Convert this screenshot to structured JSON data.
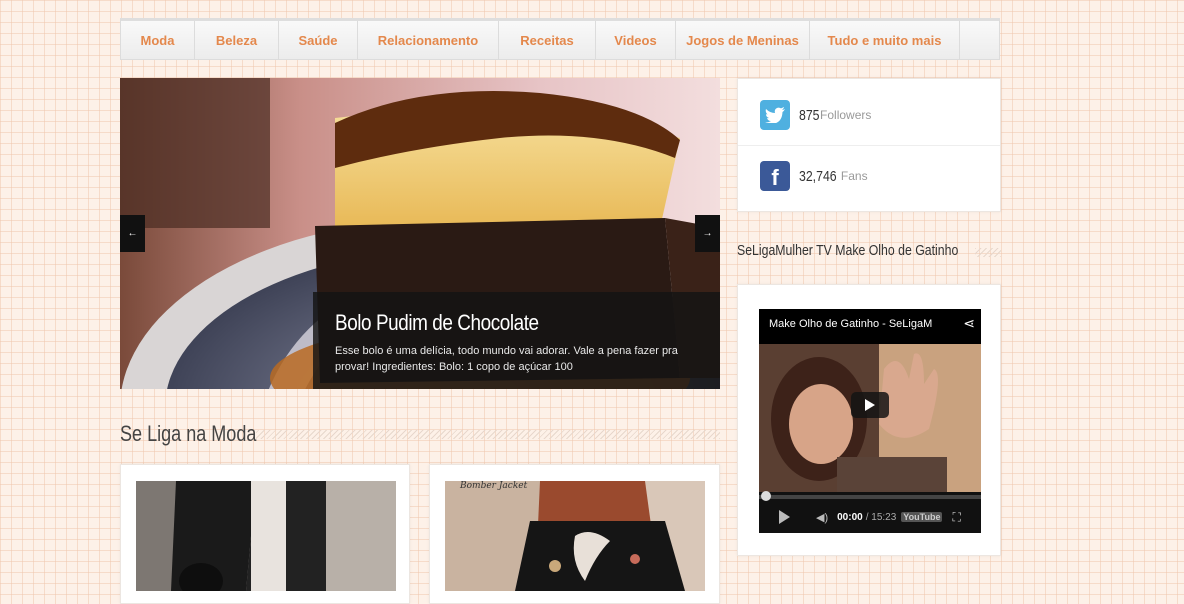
{
  "nav": {
    "items": [
      "Moda",
      "Beleza",
      "Saúde",
      "Relacionamento",
      "Receitas",
      "Videos",
      "Jogos de Meninas",
      "Tudo e muito mais"
    ]
  },
  "slider": {
    "prev_label": "←",
    "next_label": "→",
    "title": "Bolo Pudim de Chocolate",
    "excerpt": "Esse bolo é uma delícia, todo mundo vai adorar. Vale a pena fazer pra provar! Ingredientes: Bolo:  1 copo de açúcar 100"
  },
  "section_moda": {
    "title": "Se Liga na Moda"
  },
  "posts": [
    {
      "image_caption": ""
    },
    {
      "image_caption": "Bomber Jacket"
    }
  ],
  "social": {
    "twitter": {
      "count": "875",
      "label": "Followers"
    },
    "facebook": {
      "count": "32,746",
      "label": "Fans"
    }
  },
  "tv": {
    "title": "SeLigaMulher TV  Make Olho de Gatinho"
  },
  "video": {
    "title": "Make Olho de Gatinho - SeLigaM",
    "time_current": "00:00",
    "time_total": "/ 15:23",
    "brand": "YouTube"
  },
  "colors": {
    "accent": "#e4884c",
    "twitter": "#4fb0e0",
    "facebook": "#3b5998"
  }
}
